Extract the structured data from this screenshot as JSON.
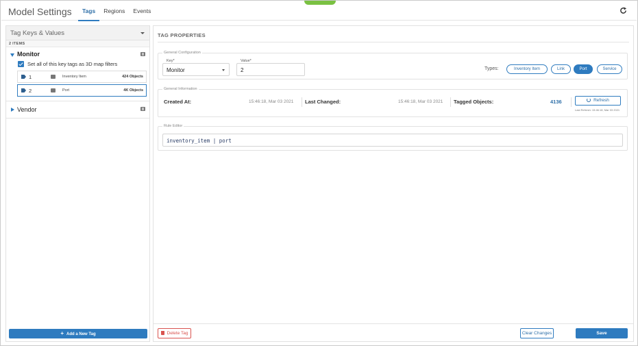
{
  "header": {
    "title": "Model Settings",
    "tabs": [
      {
        "label": "Tags",
        "active": true
      },
      {
        "label": "Regions",
        "active": false
      },
      {
        "label": "Events",
        "active": false
      }
    ]
  },
  "left_panel": {
    "dropdown_title": "Tag Keys & Values",
    "item_count": "2 ITEMS",
    "groups": [
      {
        "name": "Monitor",
        "expanded": true,
        "checkbox_label": "Set all of this key tags as 3D map filters",
        "items": [
          {
            "num": "1",
            "name": "Inventory Item",
            "count": "424 Objects"
          },
          {
            "num": "2",
            "name": "Port",
            "count": "4K Objects"
          }
        ]
      },
      {
        "name": "Vendor",
        "expanded": false
      }
    ],
    "add_button": "Add a New Tag"
  },
  "right_panel": {
    "title": "TAG PROPERTIES",
    "general_config": {
      "label": "General Configuration",
      "key_label": "Key*",
      "key_value": "Monitor",
      "value_label": "Value*",
      "value_value": "2",
      "types_label": "Types:",
      "types": [
        {
          "label": "Inventory Item",
          "active": false
        },
        {
          "label": "Link",
          "active": false
        },
        {
          "label": "Port",
          "active": true
        },
        {
          "label": "Service",
          "active": false
        }
      ]
    },
    "general_info": {
      "label": "General Information",
      "created_label": "Created At:",
      "created_value": "15:46:18, Mar 03 2021",
      "changed_label": "Last Changed:",
      "changed_value": "15:46:18, Mar 03 2021",
      "tagged_label": "Tagged Objects:",
      "tagged_value": "4136",
      "refresh_label": "Refresh",
      "last_refresh": "Last Refresh: 15:46:18, Mar 03 2021"
    },
    "rule_editor": {
      "label": "Rule Editor",
      "rule": "inventory_item | port"
    },
    "footer": {
      "delete": "Delete Tag",
      "clear": "Clear Changes",
      "save": "Save"
    }
  }
}
